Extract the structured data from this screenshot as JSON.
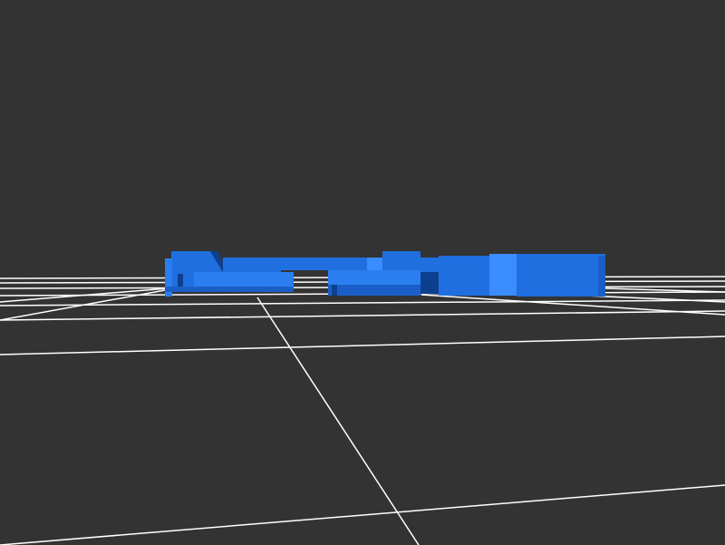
{
  "viewer": {
    "background_color": "#333333",
    "grid_color": "#ffffff",
    "model_color": "#1f6fe0",
    "model_shade_dark": "#0d3f8f",
    "model_shade_light": "#3a8cff"
  }
}
